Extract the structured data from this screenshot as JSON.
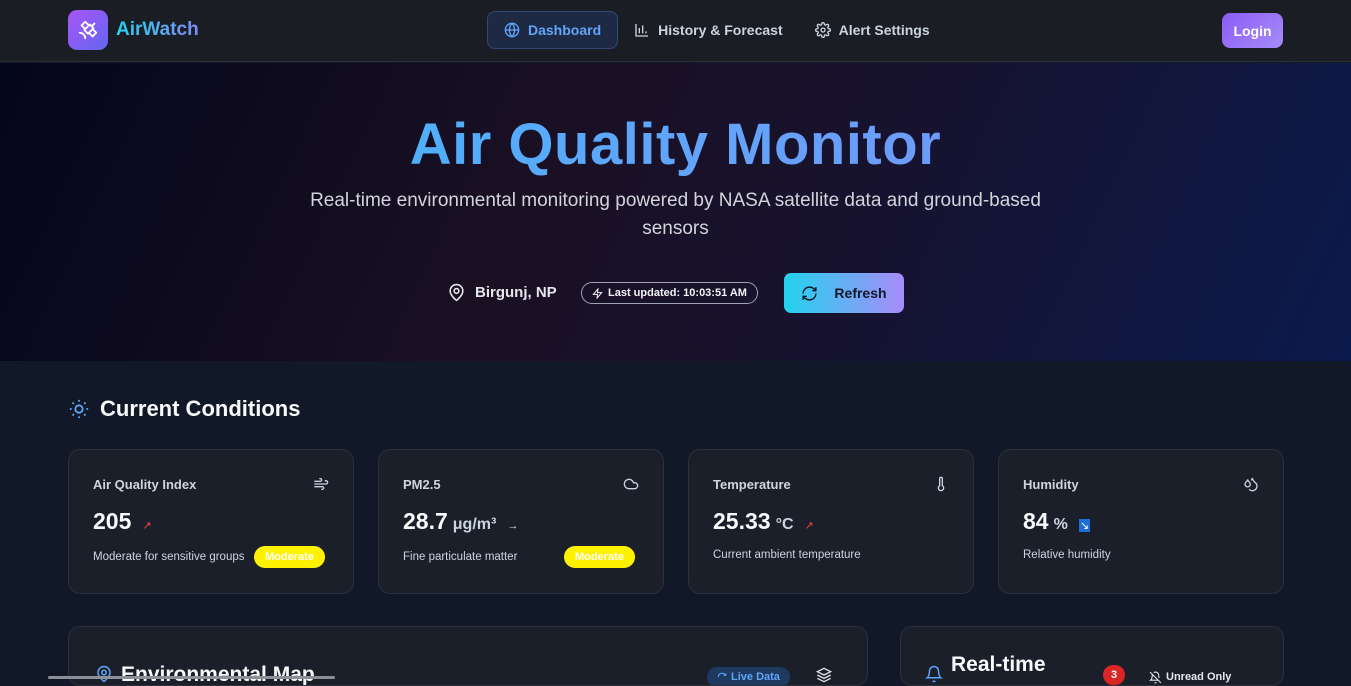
{
  "brand": {
    "name": "AirWatch"
  },
  "nav": {
    "items": [
      {
        "label": "Dashboard",
        "icon": "globe-icon",
        "active": true
      },
      {
        "label": "History & Forecast",
        "icon": "bar-chart-icon",
        "active": false
      },
      {
        "label": "Alert Settings",
        "icon": "gear-icon",
        "active": false
      }
    ],
    "login_label": "Login"
  },
  "hero": {
    "title": "Air Quality Monitor",
    "subtitle": "Real-time environmental monitoring powered by NASA satellite data and ground-based sensors",
    "location": "Birgunj, NP",
    "last_updated": "Last updated: 10:03:51 AM",
    "refresh_label": "Refresh"
  },
  "conditions": {
    "title": "Current Conditions",
    "cards": [
      {
        "label": "Air Quality Index",
        "value": "205",
        "unit": "",
        "trend": "↗",
        "trend_color": "#ef4444",
        "desc": "Moderate for sensitive groups",
        "badge": "Moderate",
        "icon": "wind-icon"
      },
      {
        "label": "PM2.5",
        "value": "28.7",
        "unit": "μg/m³",
        "trend": "→",
        "trend_color": "#e5e7eb",
        "desc": "Fine particulate matter",
        "badge": "Moderate",
        "icon": "cloud-icon"
      },
      {
        "label": "Temperature",
        "value": "25.33",
        "unit": "°C",
        "trend": "↗",
        "trend_color": "#ef4444",
        "desc": "Current ambient temperature",
        "badge": "",
        "icon": "thermometer-icon"
      },
      {
        "label": "Humidity",
        "value": "84",
        "unit": "%",
        "trend": "↘",
        "trend_color": "#3b82f6",
        "desc": "Relative humidity",
        "badge": "",
        "icon": "droplets-icon"
      }
    ],
    "badge_color": "#fff200"
  },
  "panels": {
    "map_title": "Environmental Map",
    "live_label": "Live Data",
    "alerts_title": "Real-time",
    "alert_count": "3",
    "unread_label": "Unread Only"
  }
}
